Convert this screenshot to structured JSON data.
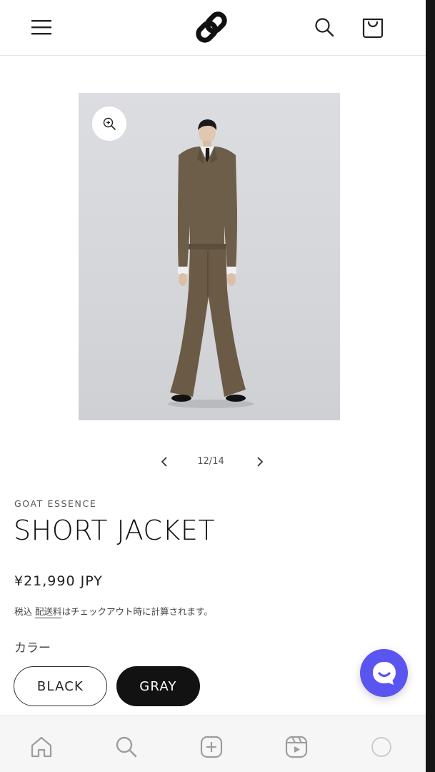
{
  "header": {
    "menu_icon": "hamburger-menu-icon",
    "logo_icon": "link-logo-icon",
    "search_icon": "search-icon",
    "cart_icon": "shopping-bag-icon"
  },
  "media": {
    "zoom_icon": "zoom-in-icon",
    "image_alt": "Model wearing brown short jacket and flared trousers"
  },
  "slider": {
    "counter": "12/14",
    "prev_icon": "chevron-left-icon",
    "next_icon": "chevron-right-icon"
  },
  "product": {
    "vendor": "GOAT ESSENCE",
    "title": "SHORT JACKET",
    "price": "¥21,990 JPY",
    "tax_prefix": "税込 ",
    "shipping_link": "配送料",
    "tax_suffix": "はチェックアウト時に計算されます。",
    "option_label": "カラー",
    "options": [
      {
        "label": "BLACK",
        "selected": false
      },
      {
        "label": "GRAY",
        "selected": true
      }
    ]
  },
  "chat": {
    "icon": "chat-bubble-icon",
    "color": "#5a55f1"
  },
  "bottom_nav": {
    "items": [
      "home-icon",
      "search-icon",
      "add-post-icon",
      "reels-icon",
      "profile-icon"
    ]
  }
}
